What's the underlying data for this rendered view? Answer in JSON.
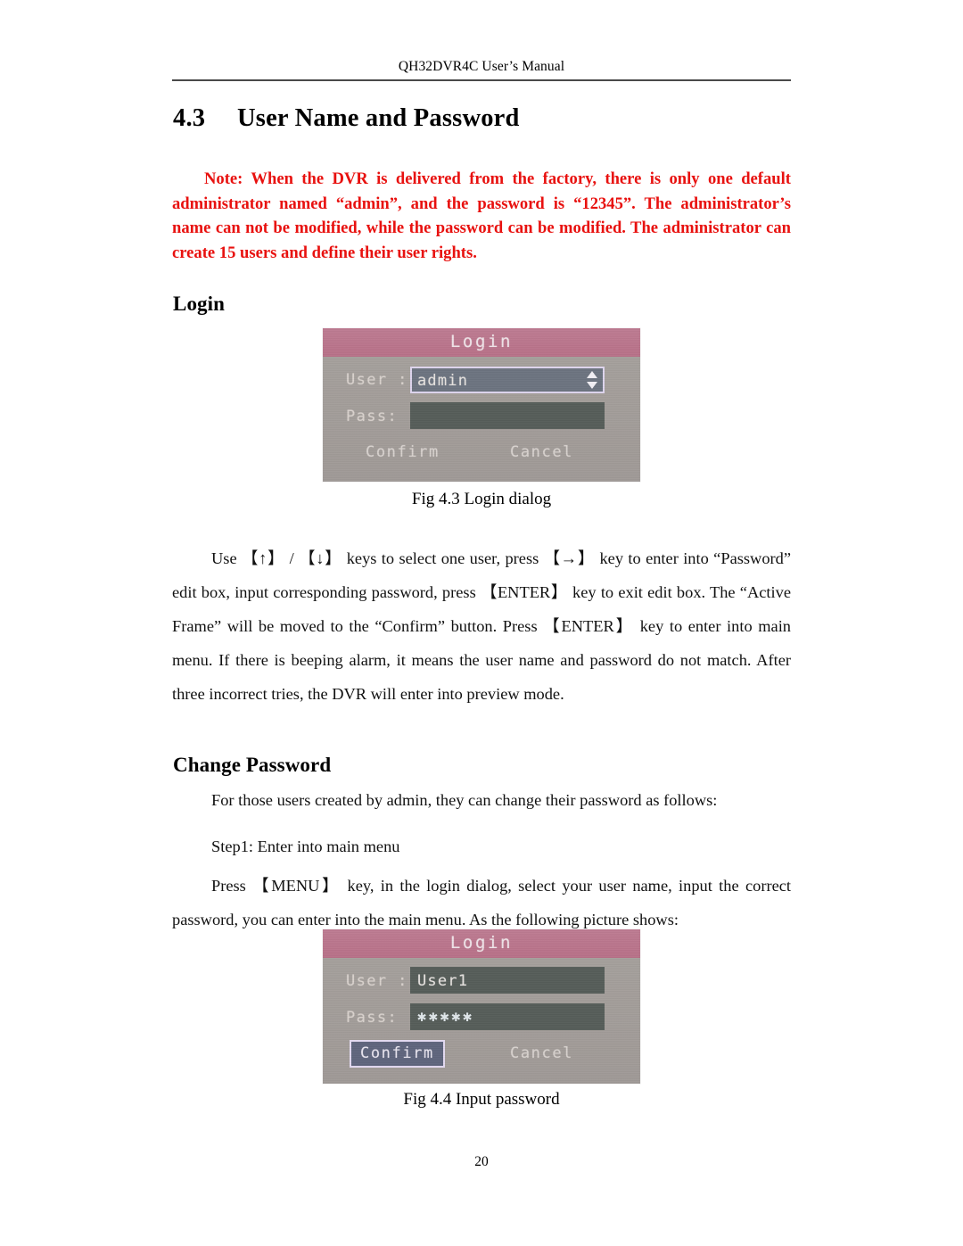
{
  "document": {
    "running_header": "QH32DVR4C User’s Manual",
    "page_number": "20"
  },
  "section": {
    "number": "4.3",
    "title": "User Name and Password"
  },
  "note": {
    "text": "Note: When the DVR is delivered from the factory, there is only one default administrator named “admin”, and the password is “12345”. The administrator’s name can not be modified, while the password can be modified. The administrator can create 15 users and define their user rights.",
    "color": "#e8110f"
  },
  "login_section": {
    "heading": "Login",
    "paragraph": "Use 【↑】 / 【↓】 keys to select one user, press 【→】 key to enter into “Password” edit box, input corresponding password, press 【ENTER】 key to exit edit box. The “Active Frame” will be moved to the “Confirm” button. Press 【ENTER】 key to enter into main menu. If there is beeping alarm, it means the user name and password do not match. After three incorrect tries, the DVR will enter into preview mode.",
    "keys": {
      "up": "【↑】",
      "down": "【↓】",
      "right": "【→】",
      "enter": "【ENTER】",
      "menu": "【MENU】"
    }
  },
  "change_password_section": {
    "heading": "Change Password",
    "intro": "For those users created by admin, they can change their password as follows:",
    "step1": "Step1: Enter into main menu",
    "step1_detail": "Press 【MENU】 key, in the login dialog, select your user name, input the correct password, you can enter into the main menu. As the following picture shows:"
  },
  "figures": [
    {
      "id": "fig-4-3",
      "caption": "Fig 4.3 Login dialog",
      "dialog": {
        "title": "Login",
        "user_label": "User :",
        "user_value": "admin",
        "user_field_state": "selected-dropdown",
        "pass_label": "Pass:",
        "pass_value": "",
        "confirm_label": "Confirm",
        "cancel_label": "Cancel",
        "active_button": "none",
        "colors": {
          "titlebar": "#bc7a90",
          "body": "#a39d9a",
          "field": "#565d59",
          "selected_field": "#6d7480",
          "highlight_border": "#ded5ee"
        }
      }
    },
    {
      "id": "fig-4-4",
      "caption": "Fig 4.4 Input password",
      "dialog": {
        "title": "Login",
        "user_label": "User :",
        "user_value": "User1",
        "user_field_state": "filled",
        "pass_label": "Pass:",
        "pass_value": "✱✱✱✱✱",
        "confirm_label": "Confirm",
        "cancel_label": "Cancel",
        "active_button": "Confirm",
        "colors": {
          "titlebar": "#bc7a90",
          "body": "#a39d9a",
          "field": "#565d59",
          "active_button": "#5f657d",
          "highlight_border": "#e3daf1"
        }
      }
    }
  ]
}
